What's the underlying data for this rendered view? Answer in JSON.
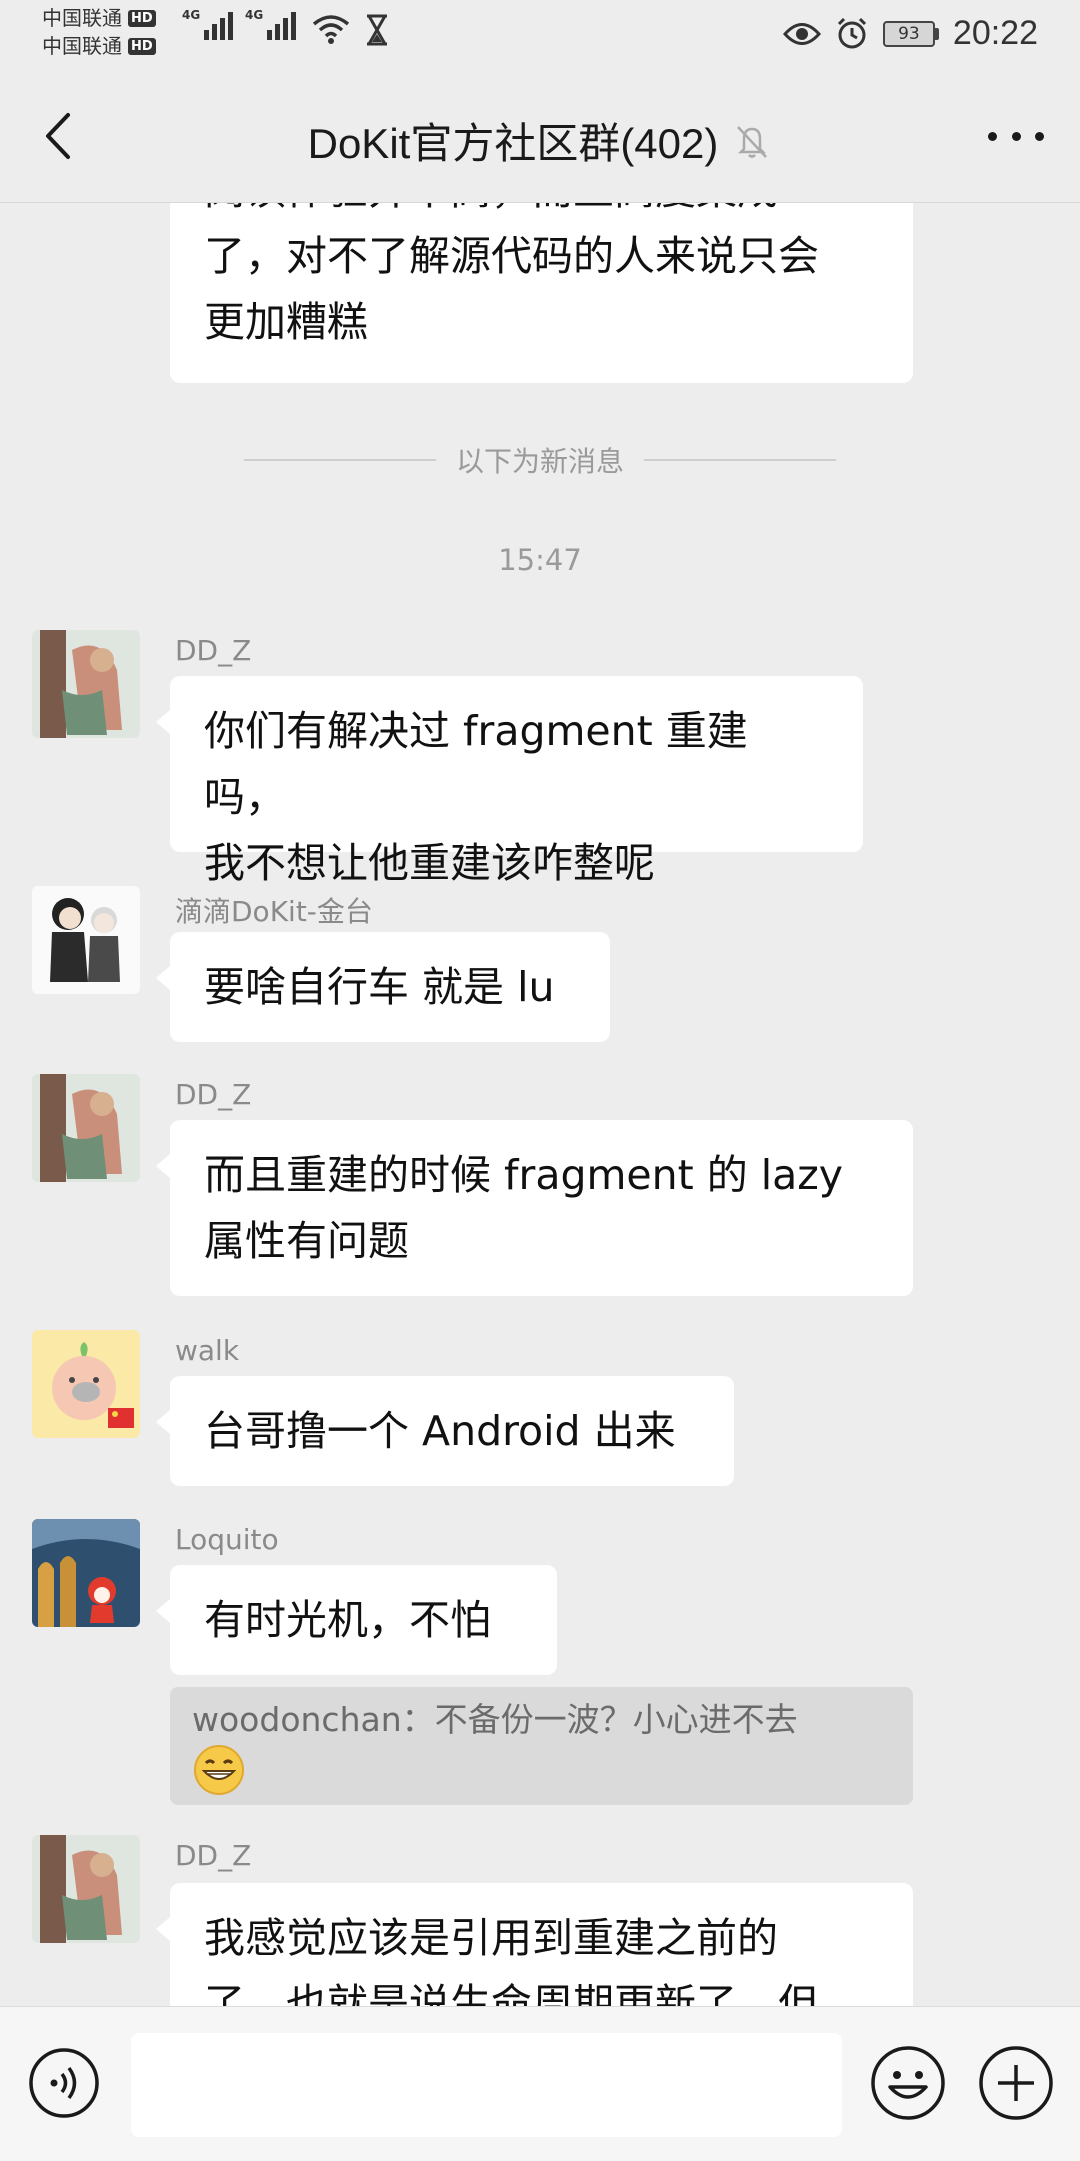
{
  "status_bar": {
    "carrier_1": "中国联通",
    "carrier_2": "中国联通",
    "hd_label": "HD",
    "network_label": "4G",
    "battery": "93",
    "time": "20:22",
    "icons": [
      "signal-icon",
      "wifi-icon",
      "hourglass-icon",
      "eye-icon",
      "alarm-icon",
      "battery-icon"
    ]
  },
  "header": {
    "title": "DoKit官方社区群(402)",
    "muted_icon": "bell-off-icon",
    "back_icon": "chevron-left-icon",
    "more_icon": "more-dots-icon"
  },
  "chat": {
    "previous_message_tail": [
      "阅读体验并不高，而且高度集成",
      "了，对不了解源代码的人来说只会",
      "更加糟糕"
    ],
    "new_messages_divider": "以下为新消息",
    "timestamp": "15:47",
    "messages": [
      {
        "sender": "DD_Z",
        "lines": [
          "你们有解决过 fragment 重建吗，",
          "我不想让他重建该咋整呢"
        ]
      },
      {
        "sender": "滴滴DoKit-金台",
        "lines": [
          "要啥自行车 就是 lu"
        ]
      },
      {
        "sender": "DD_Z",
        "lines": [
          "而且重建的时候 fragment 的 lazy",
          "属性有问题"
        ]
      },
      {
        "sender": "walk",
        "lines": [
          "台哥撸一个 Android 出来"
        ]
      },
      {
        "sender": "Loquito",
        "lines": [
          "有时光机，不怕"
        ]
      },
      {
        "sender": "DD_Z",
        "lines": [
          "我感觉应该是引用到重建之前的",
          "了，也就是说生命周期更新了，但"
        ]
      }
    ],
    "quote": {
      "text": "woodonchan：不备份一波？小心进不去",
      "emoji": "grinning-emoji"
    }
  },
  "input_bar": {
    "placeholder": "",
    "voice_icon": "voice-icon",
    "emoji_icon": "smiley-icon",
    "plus_icon": "plus-icon"
  },
  "colors": {
    "background": "#ededed",
    "bubble": "#ffffff",
    "quote_bg": "#dadada",
    "name_text": "#8a8a8a"
  }
}
